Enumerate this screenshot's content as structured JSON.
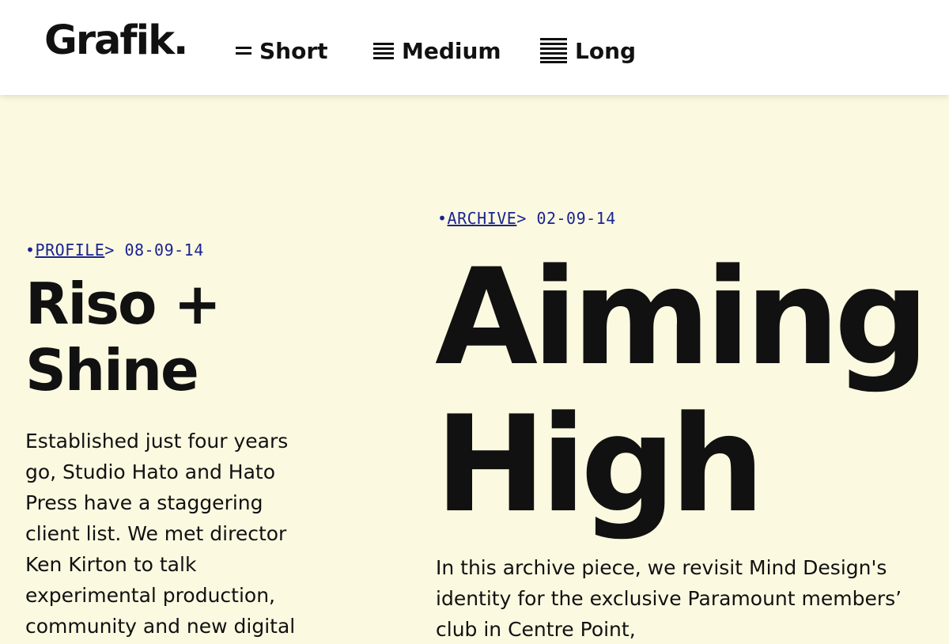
{
  "header": {
    "logo": "Grafik.",
    "nav": [
      {
        "label": "Short",
        "icon": "two-lines-icon"
      },
      {
        "label": "Medium",
        "icon": "four-lines-icon"
      },
      {
        "label": "Long",
        "icon": "six-lines-icon"
      }
    ]
  },
  "articles": [
    {
      "bullet": "•",
      "category": "PROFILE",
      "arrow": ">",
      "date": "08-09-14",
      "title": "Riso + Shine",
      "excerpt": "Established just four years go, Studio Hato and Hato Press have a staggering client list. We met director Ken Kirton to talk experimental production, community and new digital"
    },
    {
      "bullet": "•",
      "category": "ARCHIVE",
      "arrow": ">",
      "date": "02-09-14",
      "title": "Aiming High",
      "excerpt": "In this archive piece, we revisit Mind Design's identity for the exclusive Paramount members’ club in Centre Point,"
    }
  ],
  "colors": {
    "background": "#fcf9e1",
    "header": "#ffffff",
    "text": "#111111",
    "link": "#1a2490"
  }
}
